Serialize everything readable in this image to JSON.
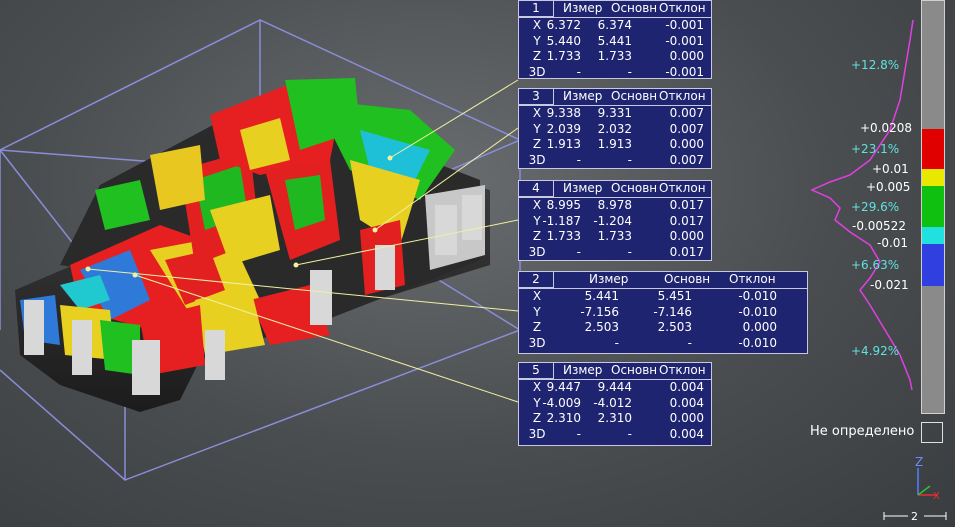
{
  "panels": [
    {
      "id": "1",
      "headers": [
        "Измер",
        "Основн",
        "Отклон"
      ],
      "rows": [
        [
          "X",
          "6.372",
          "6.374",
          "-0.001"
        ],
        [
          "Y",
          "5.440",
          "5.441",
          "-0.001"
        ],
        [
          "Z",
          "1.733",
          "1.733",
          "0.000"
        ],
        [
          "3D",
          "-",
          "-",
          "-0.001"
        ]
      ]
    },
    {
      "id": "3",
      "headers": [
        "Измер",
        "Основн",
        "Отклон"
      ],
      "rows": [
        [
          "X",
          "9.338",
          "9.331",
          "0.007"
        ],
        [
          "Y",
          "2.039",
          "2.032",
          "0.007"
        ],
        [
          "Z",
          "1.913",
          "1.913",
          "0.000"
        ],
        [
          "3D",
          "-",
          "-",
          "0.007"
        ]
      ]
    },
    {
      "id": "4",
      "headers": [
        "Измер",
        "Основн",
        "Отклон"
      ],
      "rows": [
        [
          "X",
          "8.995",
          "8.978",
          "0.017"
        ],
        [
          "Y",
          "-1.187",
          "-1.204",
          "0.017"
        ],
        [
          "Z",
          "1.733",
          "1.733",
          "0.000"
        ],
        [
          "3D",
          "-",
          "-",
          "0.017"
        ]
      ]
    },
    {
      "id": "2",
      "headers": [
        "Измер",
        "Основн",
        "Отклон"
      ],
      "rows": [
        [
          "X",
          "5.441",
          "5.451",
          "-0.010"
        ],
        [
          "Y",
          "-7.156",
          "-7.146",
          "-0.010"
        ],
        [
          "Z",
          "2.503",
          "2.503",
          "0.000"
        ],
        [
          "3D",
          "-",
          "-",
          "-0.010"
        ]
      ]
    },
    {
      "id": "5",
      "headers": [
        "Измер",
        "Основн",
        "Отклон"
      ],
      "rows": [
        [
          "X",
          "9.447",
          "9.444",
          "0.004"
        ],
        [
          "Y",
          "-4.009",
          "-4.012",
          "0.004"
        ],
        [
          "Z",
          "2.310",
          "2.310",
          "0.000"
        ],
        [
          "3D",
          "-",
          "-",
          "0.004"
        ]
      ]
    }
  ],
  "legend": {
    "percentages": [
      "+12.8%",
      "+23.1%",
      "+29.6%",
      "+6.63%",
      "+4.92%"
    ],
    "thresholds": [
      "+0.0208",
      "+0.01",
      "+0.005",
      "-0.00522",
      "-0.01",
      "-0.021"
    ],
    "band_colors": [
      "#e00000",
      "#e8e800",
      "#10c010",
      "#20e0e0",
      "#3040e0"
    ],
    "undefined_label": "Не определено"
  },
  "axes": {
    "z_label": "Z"
  },
  "scale": {
    "label": "2"
  }
}
